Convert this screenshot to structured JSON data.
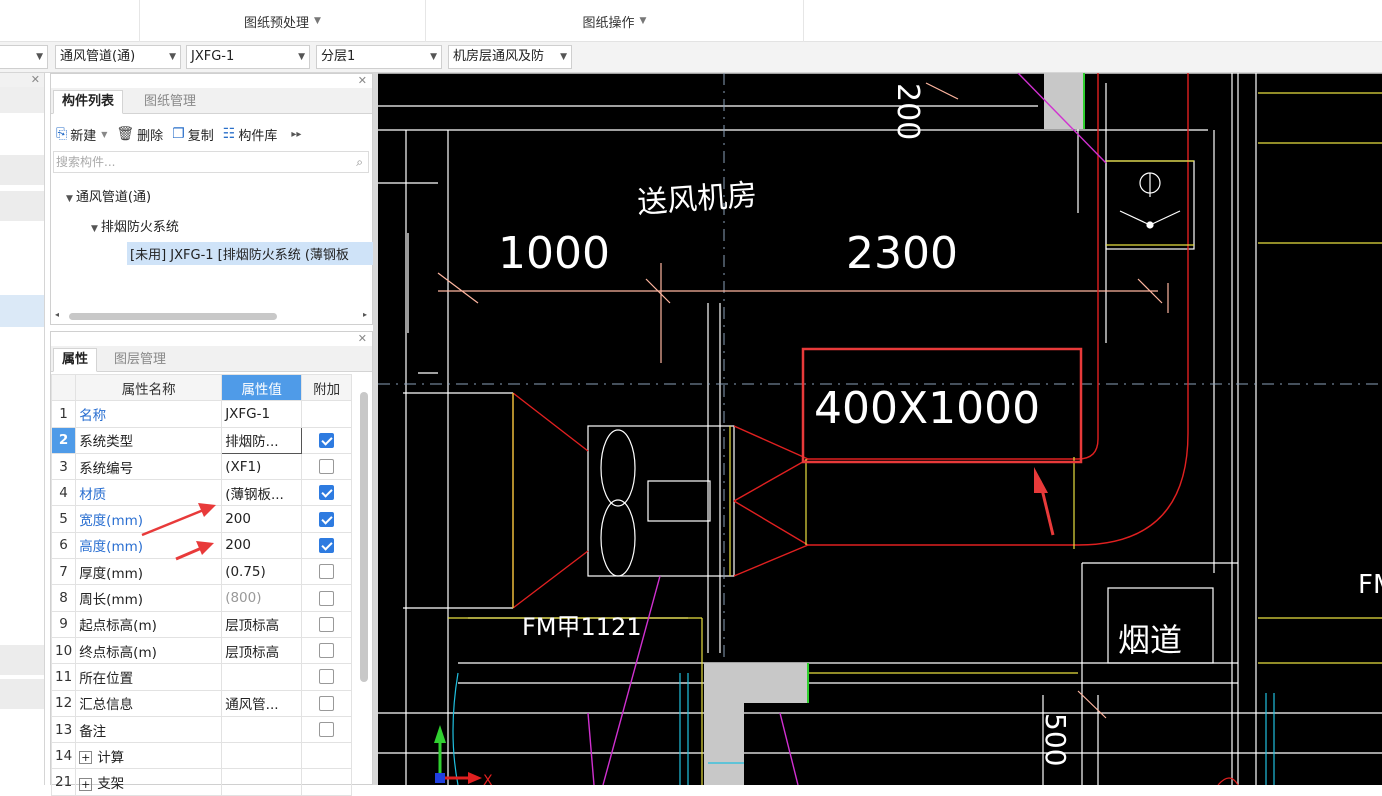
{
  "ribbon": {
    "groups": [
      {
        "label": "图纸预处理"
      },
      {
        "label": "图纸操作"
      }
    ]
  },
  "toolbar": {
    "dropdowns": [
      {
        "value": ""
      },
      {
        "value": "通风管道(通)"
      },
      {
        "value": "JXFG-1"
      },
      {
        "value": "分层1"
      },
      {
        "value": "机房层通风及防"
      }
    ]
  },
  "component_panel": {
    "tabs": [
      {
        "label": "构件列表",
        "active": true
      },
      {
        "label": "图纸管理",
        "active": false
      }
    ],
    "tools": {
      "new": "新建",
      "delete": "删除",
      "copy": "复制",
      "library": "构件库"
    },
    "search_placeholder": "搜索构件...",
    "tree": {
      "root": "通风管道(通)",
      "child": "排烟防火系统",
      "leaf": "[未用] JXFG-1 [排烟防火系统 (薄钢板"
    }
  },
  "props_panel": {
    "tabs": [
      {
        "label": "属性",
        "active": true
      },
      {
        "label": "图层管理",
        "active": false
      }
    ],
    "headers": {
      "name": "属性名称",
      "value": "属性值",
      "extra": "附加"
    },
    "rows": [
      {
        "no": "1",
        "name": "名称",
        "value": "JXFG-1",
        "checkbox": null,
        "name_blue": true
      },
      {
        "no": "2",
        "name": "系统类型",
        "value": "排烟防...",
        "checkbox": true,
        "name_blue": false,
        "selected": true
      },
      {
        "no": "3",
        "name": "系统编号",
        "value": "(XF1)",
        "checkbox": false,
        "name_blue": false
      },
      {
        "no": "4",
        "name": "材质",
        "value": "(薄钢板...",
        "checkbox": true,
        "name_blue": true
      },
      {
        "no": "5",
        "name": "宽度(mm)",
        "value": "200",
        "checkbox": true,
        "name_blue": true
      },
      {
        "no": "6",
        "name": "高度(mm)",
        "value": "200",
        "checkbox": true,
        "name_blue": true
      },
      {
        "no": "7",
        "name": "厚度(mm)",
        "value": "(0.75)",
        "checkbox": false,
        "name_blue": false
      },
      {
        "no": "8",
        "name": "周长(mm)",
        "value": "(800)",
        "checkbox": false,
        "name_blue": false,
        "value_gray": true
      },
      {
        "no": "9",
        "name": "起点标高(m)",
        "value": "层顶标高",
        "checkbox": false,
        "name_blue": false
      },
      {
        "no": "10",
        "name": "终点标高(m)",
        "value": "层顶标高",
        "checkbox": false,
        "name_blue": false
      },
      {
        "no": "11",
        "name": "所在位置",
        "value": "",
        "checkbox": false,
        "name_blue": false
      },
      {
        "no": "12",
        "name": "汇总信息",
        "value": "通风管...",
        "checkbox": false,
        "name_blue": false
      },
      {
        "no": "13",
        "name": "备注",
        "value": "",
        "checkbox": false,
        "name_blue": false
      },
      {
        "no": "14",
        "name": "计算",
        "value": "",
        "checkbox": null,
        "name_blue": false,
        "expand": true
      },
      {
        "no": "21",
        "name": "支架",
        "value": "",
        "checkbox": null,
        "name_blue": false,
        "expand": true
      }
    ]
  },
  "cad": {
    "labels": {
      "room": "送风机房",
      "dim_left": "1000",
      "dim_right": "2300",
      "duct_size": "400X1000",
      "vertical_dim": "200",
      "damper": "FM甲1121",
      "flue": "烟道",
      "edge_text": "FM",
      "bottom_dim": "500",
      "axis_x": "X"
    }
  }
}
